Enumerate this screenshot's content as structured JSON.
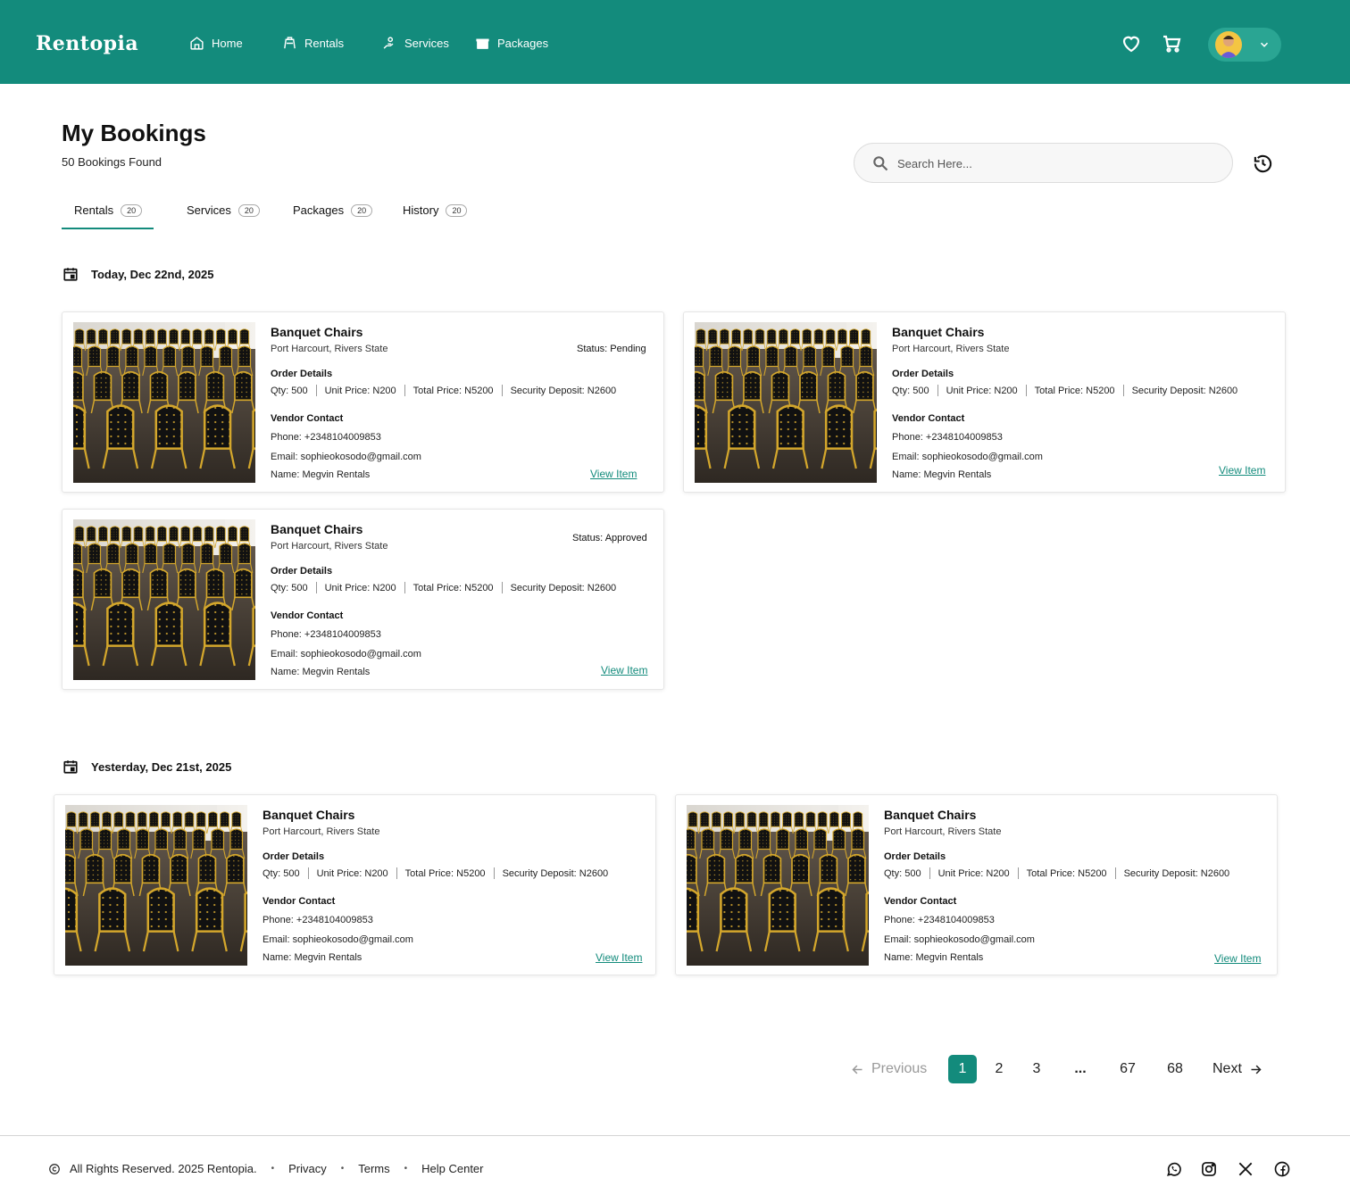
{
  "header": {
    "brand": "Rentopia",
    "nav": [
      {
        "label": "Home",
        "icon": "home-icon"
      },
      {
        "label": "Rentals",
        "icon": "rentals-icon"
      },
      {
        "label": "Services",
        "icon": "services-icon"
      },
      {
        "label": "Packages",
        "icon": "packages-icon"
      }
    ],
    "accent_color": "#138B7C"
  },
  "page": {
    "title": "My Bookings",
    "subtitle": "50 Bookings Found"
  },
  "search": {
    "placeholder": "Search Here..."
  },
  "tabs": [
    {
      "label": "Rentals",
      "count": "20"
    },
    {
      "label": "Services",
      "count": "20"
    },
    {
      "label": "Packages",
      "count": "20"
    },
    {
      "label": "History",
      "count": "20"
    }
  ],
  "groups": [
    {
      "date": "Today, Dec 22nd, 2025",
      "bookings": [
        {
          "title": "Banquet Chairs",
          "location": "Port Harcourt, Rivers State",
          "status": "Status: Pending",
          "order_heading": "Order Details",
          "qty": "Qty:  500",
          "unit_price": "Unit Price:  N200",
          "total_price": "Total Price:  N5200",
          "deposit": "Security Deposit:  N2600",
          "vendor_heading": "Vendor Contact",
          "phone": "Phone:  +2348104009853",
          "email": "Email:   sophieokosodo@gmail.com",
          "name": "Name:  Megvin Rentals",
          "link": "View Item"
        },
        {
          "title": "Banquet Chairs",
          "location": "Port Harcourt, Rivers State",
          "status": "",
          "order_heading": "Order Details",
          "qty": "Qty:  500",
          "unit_price": "Unit Price:  N200",
          "total_price": "Total Price:  N5200",
          "deposit": "Security Deposit:  N2600",
          "vendor_heading": "Vendor Contact",
          "phone": "Phone:  +2348104009853",
          "email": "Email:   sophieokosodo@gmail.com",
          "name": "Name:  Megvin Rentals",
          "link": "View Item"
        },
        {
          "title": "Banquet Chairs",
          "location": "Port Harcourt, Rivers State",
          "status": "Status: Approved",
          "order_heading": "Order Details",
          "qty": "Qty:  500",
          "unit_price": "Unit Price:  N200",
          "total_price": "Total Price:  N5200",
          "deposit": "Security Deposit:  N2600",
          "vendor_heading": "Vendor Contact",
          "phone": "Phone:  +2348104009853",
          "email": "Email:   sophieokosodo@gmail.com",
          "name": "Name:  Megvin Rentals",
          "link": "View Item"
        }
      ]
    },
    {
      "date": "Yesterday, Dec 21st, 2025",
      "bookings": [
        {
          "title": "Banquet Chairs",
          "location": "Port Harcourt, Rivers State",
          "status": "",
          "order_heading": "Order Details",
          "qty": "Qty:  500",
          "unit_price": "Unit Price:  N200",
          "total_price": "Total Price:  N5200",
          "deposit": "Security Deposit:  N2600",
          "vendor_heading": "Vendor Contact",
          "phone": "Phone:  +2348104009853",
          "email": "Email:   sophieokosodo@gmail.com",
          "name": "Name:  Megvin Rentals",
          "link": "View Item"
        },
        {
          "title": "Banquet Chairs",
          "location": "Port Harcourt, Rivers State",
          "status": "",
          "order_heading": "Order Details",
          "qty": "Qty:  500",
          "unit_price": "Unit Price:  N200",
          "total_price": "Total Price:  N5200",
          "deposit": "Security Deposit:  N2600",
          "vendor_heading": "Vendor Contact",
          "phone": "Phone:  +2348104009853",
          "email": "Email:   sophieokosodo@gmail.com",
          "name": "Name:  Megvin Rentals",
          "link": "View Item"
        }
      ]
    }
  ],
  "pagination": {
    "previous": "Previous",
    "pages": [
      "1",
      "2",
      "3",
      "...",
      "67",
      "68"
    ],
    "current": "1",
    "next": "Next"
  },
  "footer": {
    "copyright": "All Rights Reserved. 2025 Rentopia.",
    "links": [
      "Privacy",
      "Terms",
      "Help Center"
    ],
    "social": [
      "whatsapp-icon",
      "instagram-icon",
      "x-icon",
      "facebook-icon"
    ]
  }
}
